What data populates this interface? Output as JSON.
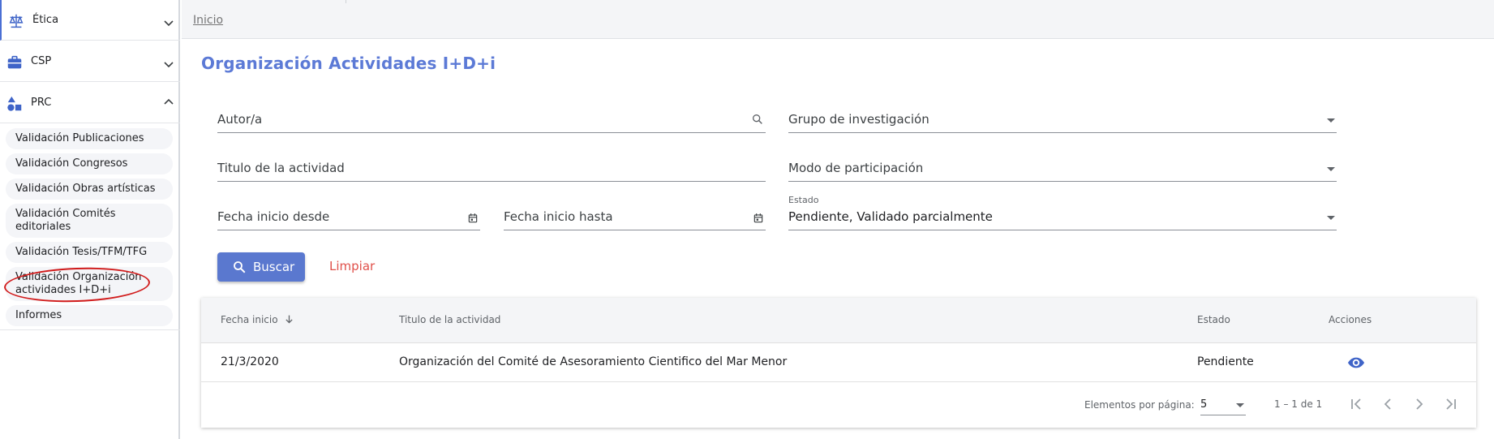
{
  "sidebar": {
    "sections": [
      {
        "label": "Ética",
        "icon": "scales-icon",
        "expanded": false
      },
      {
        "label": "CSP",
        "icon": "briefcase-icon",
        "expanded": false
      },
      {
        "label": "PRC",
        "icon": "shapes-icon",
        "expanded": true
      }
    ],
    "items": [
      {
        "label": "Validación Publicaciones"
      },
      {
        "label": "Validación Congresos"
      },
      {
        "label": "Validación Obras artísticas"
      },
      {
        "label": "Validación Comités editoriales"
      },
      {
        "label": "Validación Tesis/TFM/TFG"
      },
      {
        "label": "Validación Organización actividades I+D+i"
      },
      {
        "label": "Informes"
      }
    ],
    "highlight_color": "#d11b1b"
  },
  "breadcrumb": {
    "home": "Inicio"
  },
  "page": {
    "title": "Organización Actividades I+D+i"
  },
  "filters": {
    "autor": {
      "placeholder": "Autor/a",
      "icon": "search-icon"
    },
    "grupo": {
      "placeholder": "Grupo de investigación"
    },
    "titulo": {
      "placeholder": "Titulo de la actividad"
    },
    "modo": {
      "placeholder": "Modo de participación"
    },
    "fecha_desde": {
      "placeholder": "Fecha inicio desde",
      "icon": "calendar-icon"
    },
    "fecha_hasta": {
      "placeholder": "Fecha inicio hasta",
      "icon": "calendar-icon"
    },
    "estado": {
      "label": "Estado",
      "value": "Pendiente, Validado parcialmente"
    }
  },
  "actions": {
    "search": "Buscar",
    "clear": "Limpiar"
  },
  "table": {
    "columns": {
      "fecha": "Fecha inicio",
      "titulo": "Titulo de la actividad",
      "estado": "Estado",
      "acciones": "Acciones"
    },
    "rows": [
      {
        "fecha": "21/3/2020",
        "titulo": "Organización del Comité de Asesoramiento Cientifico del Mar Menor",
        "estado": "Pendiente",
        "action_icon": "eye-icon"
      }
    ]
  },
  "paginator": {
    "label": "Elementos por página:",
    "page_size": "5",
    "range": "1 – 1 de 1"
  },
  "colors": {
    "accent": "#5a78cf",
    "title": "#5c7ad6",
    "clear": "#e0504a",
    "icon": "#3f64c8"
  }
}
